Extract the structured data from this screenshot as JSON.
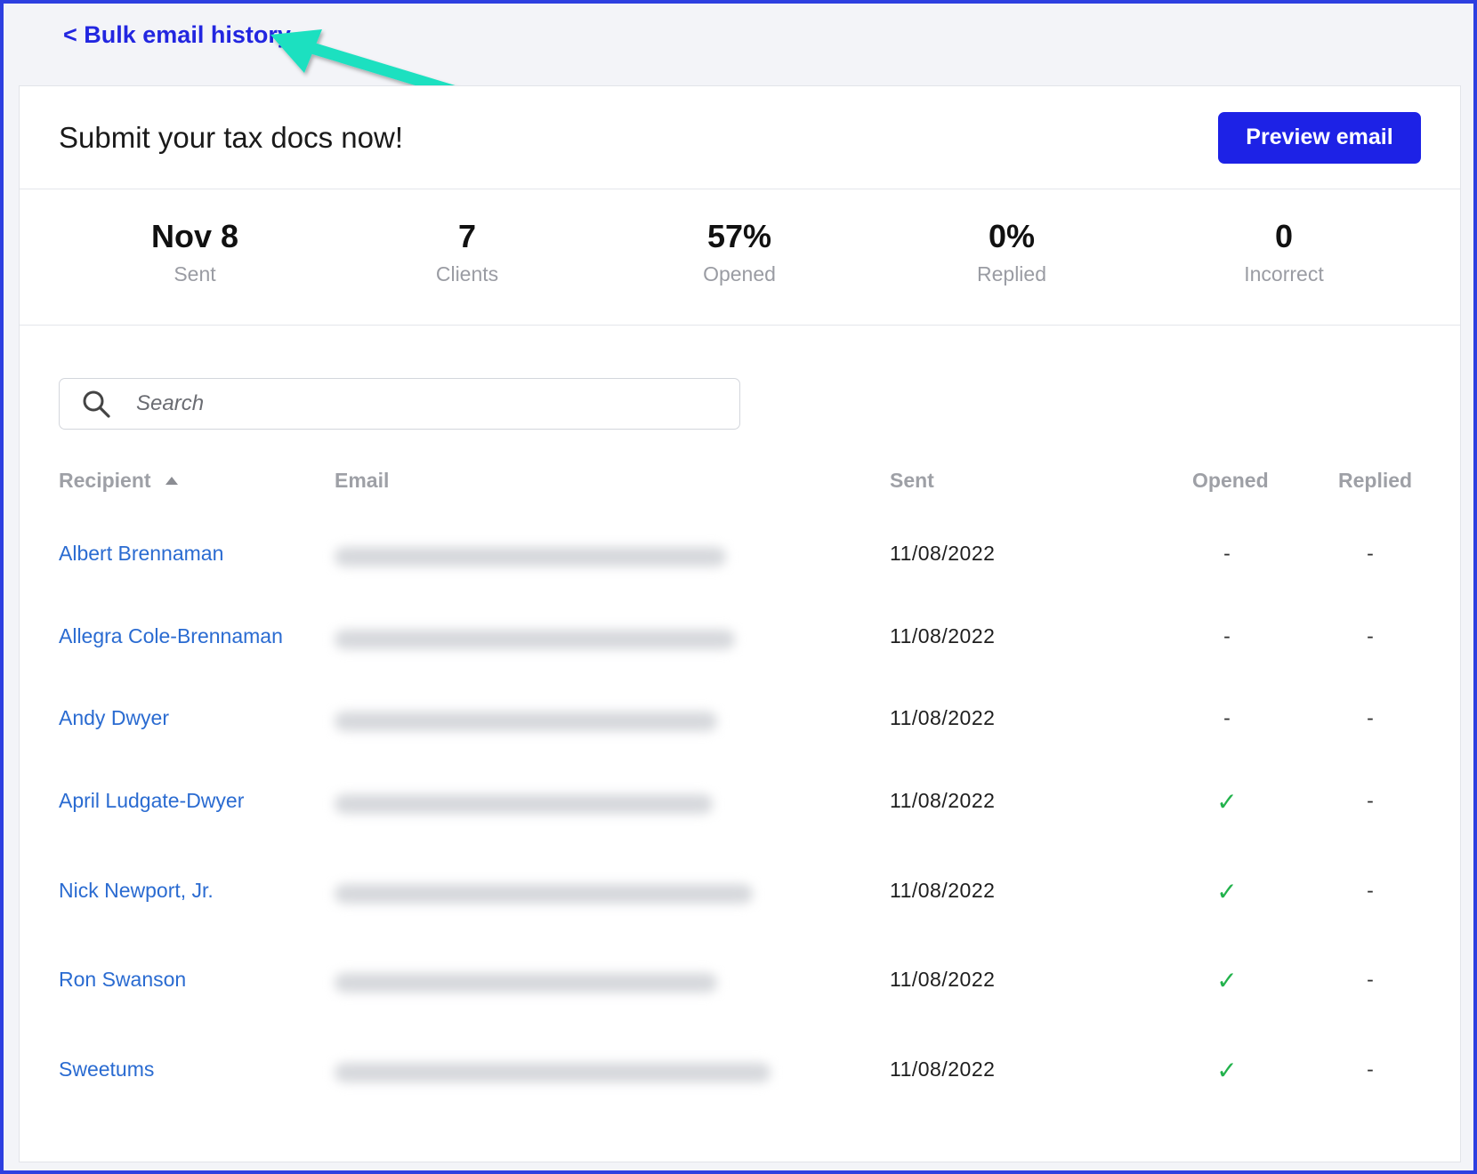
{
  "nav": {
    "back_label": "< Bulk email history"
  },
  "header": {
    "title": "Submit your tax docs now!",
    "preview_label": "Preview email"
  },
  "stats": [
    {
      "value": "Nov 8",
      "label": "Sent"
    },
    {
      "value": "7",
      "label": "Clients"
    },
    {
      "value": "57%",
      "label": "Opened"
    },
    {
      "value": "0%",
      "label": "Replied"
    },
    {
      "value": "0",
      "label": "Incorrect"
    }
  ],
  "search": {
    "placeholder": "Search",
    "icon": "search-icon"
  },
  "table": {
    "headers": {
      "recipient": "Recipient",
      "email": "Email",
      "sent": "Sent",
      "opened": "Opened",
      "replied": "Replied"
    },
    "sort_icon": "sort-ascending-icon",
    "rows": [
      {
        "name": "Albert Brennaman",
        "sent": "11/08/2022",
        "opened": "-",
        "replied": "-"
      },
      {
        "name": "Allegra Cole-Brennaman",
        "sent": "11/08/2022",
        "opened": "-",
        "replied": "-"
      },
      {
        "name": "Andy Dwyer",
        "sent": "11/08/2022",
        "opened": "-",
        "replied": "-"
      },
      {
        "name": "April Ludgate-Dwyer",
        "sent": "11/08/2022",
        "opened": "✓",
        "replied": "-"
      },
      {
        "name": "Nick Newport, Jr.",
        "sent": "11/08/2022",
        "opened": "✓",
        "replied": "-"
      },
      {
        "name": "Ron Swanson",
        "sent": "11/08/2022",
        "opened": "✓",
        "replied": "-"
      },
      {
        "name": "Sweetums",
        "sent": "11/08/2022",
        "opened": "✓",
        "replied": "-"
      }
    ]
  },
  "colors": {
    "accent": "#1d22e6",
    "link": "#2a6bd1",
    "check": "#22b24c",
    "annotation_arrow": "#1de0c0",
    "frame_border": "#2d3fe0"
  }
}
